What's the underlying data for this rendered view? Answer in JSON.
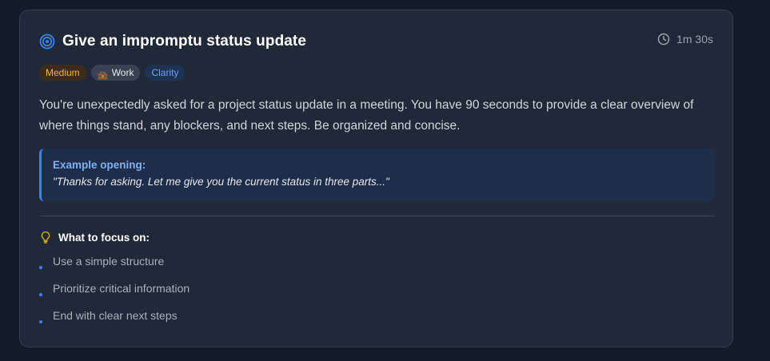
{
  "card": {
    "title": "Give an impromptu status update",
    "duration": "1m 30s",
    "tags": [
      {
        "label": "Medium",
        "color": "#f2b43c"
      },
      {
        "label": "Work",
        "icon": "briefcase-icon"
      },
      {
        "label": "Clarity",
        "color": "#6ea2ef"
      }
    ],
    "description": "You're unexpectedly asked for a project status update in a meeting. You have 90 seconds to provide a clear overview of where things stand, any blockers, and next steps. Be organized and concise.",
    "example": {
      "label": "Example opening:",
      "text": "\"Thanks for asking. Let me give you the current status in three parts...\""
    },
    "focus": {
      "title": "What to focus on:",
      "items": [
        "Use a simple structure",
        "Prioritize critical information",
        "End with clear next steps"
      ]
    }
  },
  "colors": {
    "accent": "#3b82f6",
    "background": "#131a28",
    "card": "#1f2937"
  }
}
